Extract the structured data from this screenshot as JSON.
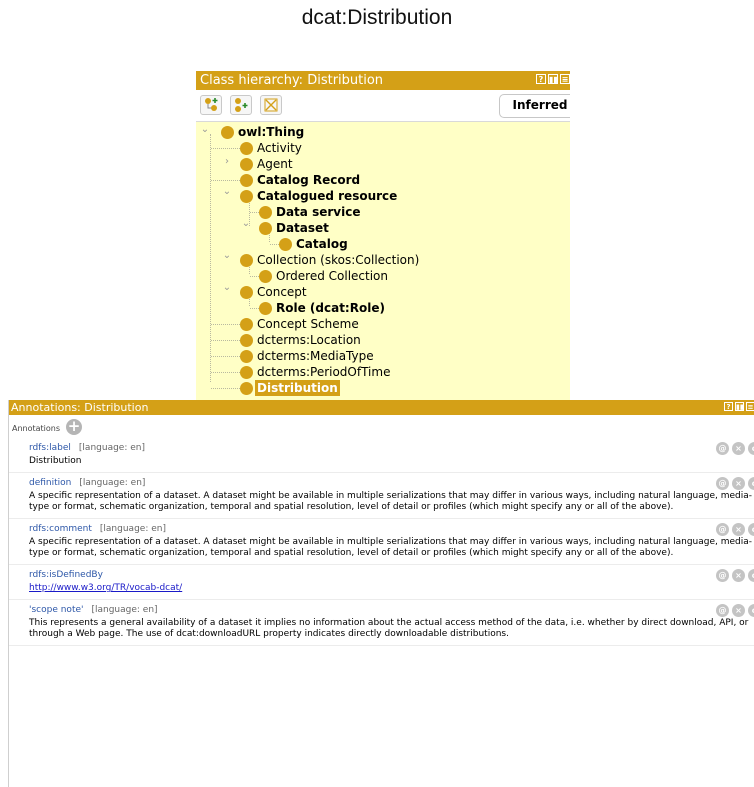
{
  "page_title": "dcat:Distribution",
  "hierarchy": {
    "title": "Class hierarchy: Distribution",
    "window_controls": [
      "?",
      "▮▮",
      "≡"
    ],
    "inferred_label": "Inferred",
    "toolbar_icons": [
      "add-subclass-icon",
      "add-sibling-icon",
      "delete-class-icon"
    ],
    "root": "owl:Thing",
    "items": [
      {
        "label": "Activity"
      },
      {
        "label": "Agent"
      },
      {
        "label": "Catalog Record"
      },
      {
        "label": "Catalogued resource"
      },
      {
        "label": "Data service"
      },
      {
        "label": "Dataset"
      },
      {
        "label": "Catalog"
      },
      {
        "label": "Collection (skos:Collection)"
      },
      {
        "label": "Ordered Collection"
      },
      {
        "label": "Concept"
      },
      {
        "label": "Role (dcat:Role)"
      },
      {
        "label": "Concept Scheme"
      },
      {
        "label": "dcterms:Location"
      },
      {
        "label": "dcterms:MediaType"
      },
      {
        "label": "dcterms:PeriodOfTime"
      },
      {
        "label": "Distribution"
      }
    ]
  },
  "annotations": {
    "title": "Annotations: Distribution",
    "header_label": "Annotations",
    "add_symbol": "+",
    "item_buttons": [
      "@",
      "×",
      "o"
    ],
    "items": [
      {
        "property": "rdfs:label",
        "lang": "[language: en]",
        "value": "Distribution"
      },
      {
        "property": "definition",
        "lang": "[language: en]",
        "value": "A specific representation of a dataset. A dataset might be available in multiple serializations that may differ in various ways, including natural language, media-type or format, schematic organization, temporal and spatial resolution, level of detail or profiles (which might specify any or all of the above)."
      },
      {
        "property": "rdfs:comment",
        "lang": "[language: en]",
        "value": "A specific representation of a dataset. A dataset might be available in multiple serializations that may differ in various ways, including natural language, media-type or format, schematic organization, temporal and spatial resolution, level of detail or profiles (which might specify any or all of the above)."
      },
      {
        "property": "rdfs:isDefinedBy",
        "lang": "",
        "value": "http://www.w3.org/TR/vocab-dcat/"
      },
      {
        "property": "'scope note'",
        "lang": "[language: en]",
        "value": "This represents a general availability of a dataset it implies no information about the actual access method of the data, i.e. whether by direct download, API, or through a Web page. The use of dcat:downloadURL property indicates directly downloadable distributions."
      }
    ]
  },
  "colors": {
    "accent": "#d4a017",
    "tree_bg": "#ffffc6",
    "link": "#2d57a8"
  }
}
